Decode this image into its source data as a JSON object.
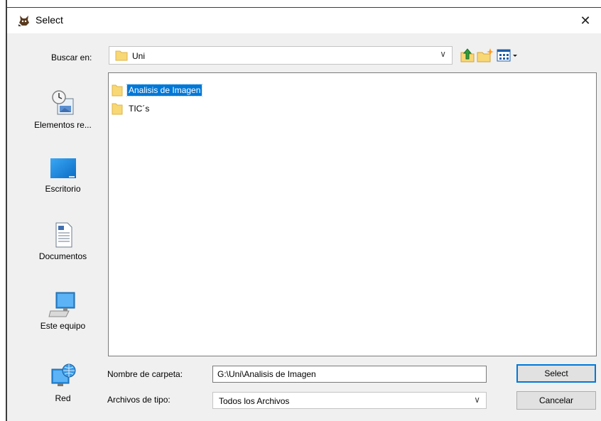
{
  "dialog": {
    "title": "Select",
    "close_glyph": "✕"
  },
  "lookin": {
    "label": "Buscar en:",
    "value": "Uni",
    "arrow": "∨",
    "toolbar_icons": [
      "up-folder-icon",
      "new-folder-icon",
      "view-menu-icon"
    ]
  },
  "places": [
    {
      "label": "Elementos re...",
      "icon": "recent-items-icon"
    },
    {
      "label": "Escritorio",
      "icon": "desktop-icon"
    },
    {
      "label": "Documentos",
      "icon": "documents-icon"
    },
    {
      "label": "Este equipo",
      "icon": "computer-icon"
    },
    {
      "label": "Red",
      "icon": "network-icon"
    }
  ],
  "files": [
    {
      "name": "Analisis de Imagen",
      "selected": true
    },
    {
      "name": "TIC´s",
      "selected": false
    }
  ],
  "filename": {
    "label": "Nombre de carpeta:",
    "value": "G:\\Uni\\Analisis de Imagen"
  },
  "filetype": {
    "label": "Archivos de tipo:",
    "value": "Todos los Archivos",
    "arrow": "∨"
  },
  "buttons": {
    "select": "Select",
    "cancel": "Cancelar"
  },
  "colors": {
    "selection": "#0078d7",
    "folder": "#f8d775",
    "dialog_bg": "#f0f0f0"
  }
}
